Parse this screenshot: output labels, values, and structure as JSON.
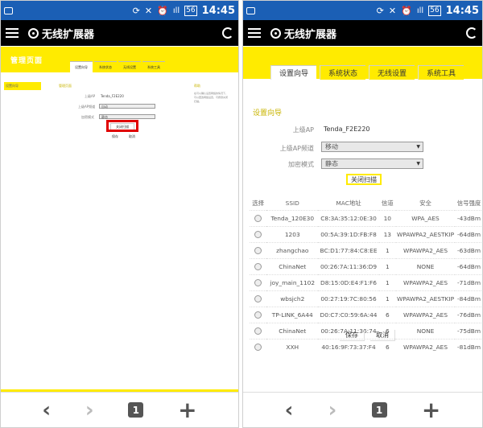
{
  "status_bar": {
    "time": "14:45",
    "signal": "ıll",
    "battery": "56"
  },
  "app": {
    "title": "无线扩展器"
  },
  "browser": {
    "tab_count": "1",
    "back": "‹",
    "forward": "›",
    "new_tab": "+"
  },
  "left_page": {
    "header_title": "管理页面",
    "tabs": [
      "设置向导",
      "系统状态",
      "无线设置",
      "系统工具"
    ],
    "sidebar_item": "设置向导",
    "section_title": "管理页面",
    "upper_ap_label": "上级AP",
    "upper_ap_value": "Tenda_F2E220",
    "channel_label": "上级AP频道",
    "channel_value": "自动",
    "encrypt_label": "加密模式",
    "encrypt_value": "静态",
    "close_scan": "关闭扫描",
    "save": "保存",
    "cancel": "取消",
    "help_title": "帮助",
    "help_text": "在可以确认设置网络的情况下，可以更改网络设置，可按键关闭扫描。"
  },
  "right_page": {
    "tabs": [
      "设置向导",
      "系统状态",
      "无线设置",
      "系统工具"
    ],
    "section_title": "设置向导",
    "upper_ap_label": "上级AP",
    "upper_ap_value": "Tenda_F2E220",
    "channel_label": "上级AP频道",
    "channel_value": "移动",
    "encrypt_label": "加密模式",
    "encrypt_value": "静态",
    "close_scan": "关闭扫描",
    "table": {
      "headers": [
        "选择",
        "SSID",
        "MAC地址",
        "信道",
        "安全",
        "信号强度"
      ],
      "rows": [
        [
          "Tenda_120E30",
          "C8:3A:35:12:0E:30",
          "10",
          "WPA_AES",
          "-43dBm"
        ],
        [
          "1203",
          "00:5A:39:1D:FB:F8",
          "13",
          "WPAWPA2_AESTKIP",
          "-64dBm"
        ],
        [
          "zhangchao",
          "BC:D1:77:84:C8:EE",
          "1",
          "WPAWPA2_AES",
          "-63dBm"
        ],
        [
          "ChinaNet",
          "00:26:7A:11:36:D9",
          "1",
          "NONE",
          "-64dBm"
        ],
        [
          "joy_main_1102",
          "D8:15:0D:E4:F1:F6",
          "1",
          "WPAWPA2_AES",
          "-71dBm"
        ],
        [
          "wbsjch2",
          "00:27:19:7C:80:56",
          "1",
          "WPAWPA2_AESTKIP",
          "-84dBm"
        ],
        [
          "TP-LINK_6A44",
          "D0:C7:C0:59:6A:44",
          "6",
          "WPAWPA2_AES",
          "-76dBm"
        ],
        [
          "ChinaNet",
          "00:26:7A:11:36:74",
          "6",
          "NONE",
          "-75dBm"
        ],
        [
          "XXH",
          "40:16:9F:73:37:F4",
          "6",
          "WPAWPA2_AES",
          "-81dBm"
        ]
      ]
    },
    "save": "保存",
    "cancel": "取消"
  }
}
